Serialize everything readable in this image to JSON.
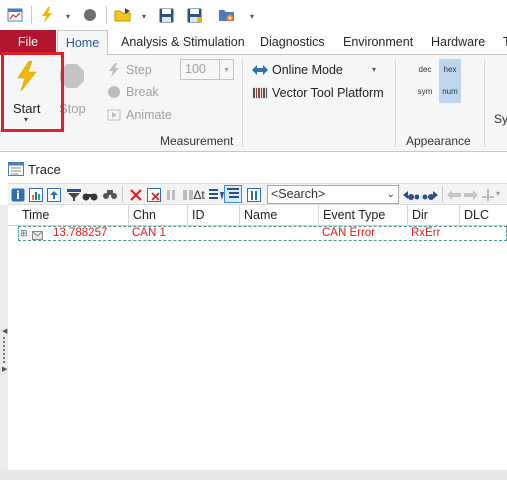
{
  "qat": {
    "icons": [
      "app-window-icon",
      "lightning-icon",
      "stop-circle-icon",
      "open-folder-icon",
      "save-icon",
      "save-as-icon",
      "save-config-icon"
    ]
  },
  "tabs": [
    "File",
    "Home",
    "Analysis & Stimulation",
    "Diagnostics",
    "Environment",
    "Hardware",
    "T"
  ],
  "ribbon": {
    "start_label": "Start",
    "start_dropdown": "▾",
    "stop_label": "Stop",
    "step_label": "Step",
    "break_label": "Break",
    "animate_label": "Animate",
    "step_value": "100",
    "online_mode_label": "Online Mode",
    "vector_tool_label": "Vector Tool Platform",
    "appearance_buttons": [
      "dec",
      "hex",
      "sym",
      "num"
    ],
    "measurement_group": "Measurement",
    "appearance_group": "Appearance",
    "cut_group": "Sy"
  },
  "trace": {
    "title": "Trace",
    "search_placeholder": "<Search>",
    "columns": [
      "Time",
      "Chn",
      "ID",
      "Name",
      "Event Type",
      "Dir",
      "DLC"
    ],
    "rows": [
      {
        "time": "13.788257",
        "chn": "CAN 1",
        "id": "",
        "name": "",
        "event_type": "CAN Error",
        "dir": "RxErr",
        "dlc": ""
      }
    ]
  },
  "colors": {
    "file_tab": "#b2142c",
    "home_tab_text": "#2b5797",
    "highlight_border": "#e21e2b",
    "error_text": "#e0201c",
    "hex_selected": "#bcd6ef"
  }
}
